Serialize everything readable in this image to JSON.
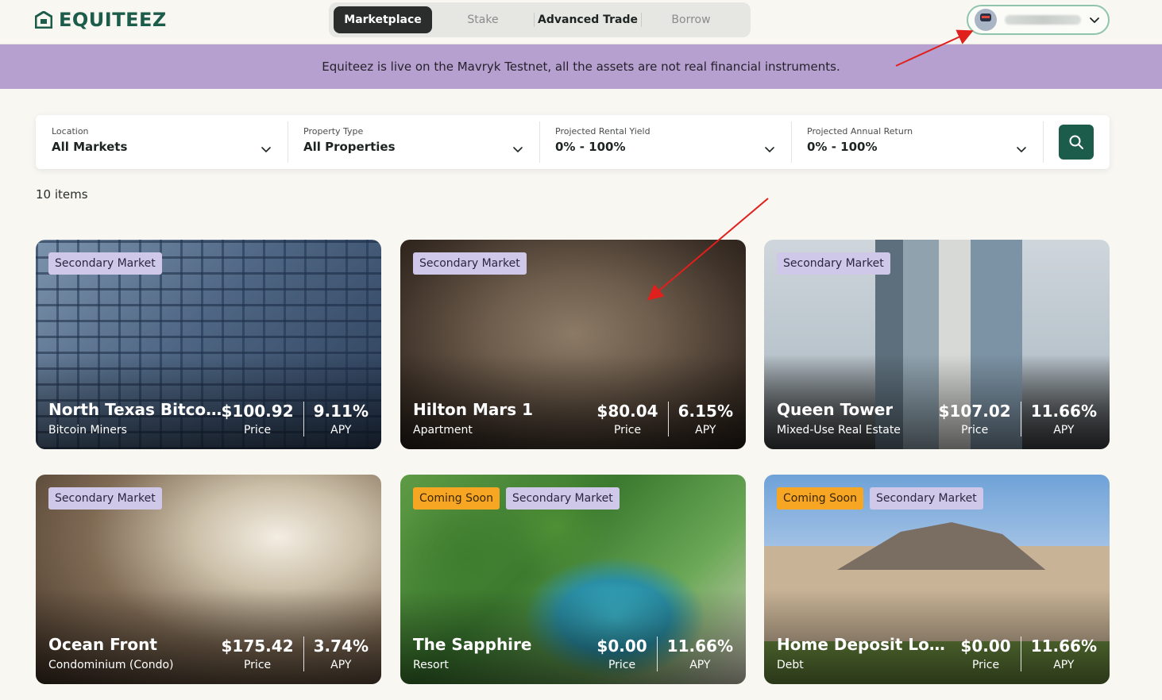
{
  "header": {
    "logo_text": "EQUITEEZ",
    "nav": [
      "Marketplace",
      "Stake",
      "Advanced Trade",
      "Borrow"
    ],
    "account": {
      "avatar_icon": "robot-avatar-icon",
      "name_blurred": true
    }
  },
  "banner": {
    "text": "Equiteez is live on the Mavryk Testnet, all the assets are not real financial instruments.",
    "color": "#b6a0cf"
  },
  "filters": [
    {
      "label": "Location",
      "value": "All Markets"
    },
    {
      "label": "Property Type",
      "value": "All Properties"
    },
    {
      "label": "Projected Rental Yield",
      "value": "0% - 100%"
    },
    {
      "label": "Projected Annual Return",
      "value": "0% - 100%"
    }
  ],
  "items_count": "10 items",
  "stat_labels": {
    "price": "Price",
    "apy": "APY"
  },
  "cards": [
    {
      "badges": [
        "Secondary Market"
      ],
      "title": "North Texas Bitcoin...",
      "subtitle": "Bitcoin Miners",
      "price": "$100.92",
      "apy": "9.11%"
    },
    {
      "badges": [
        "Secondary Market"
      ],
      "title": "Hilton Mars 1",
      "subtitle": "Apartment",
      "price": "$80.04",
      "apy": "6.15%"
    },
    {
      "badges": [
        "Secondary Market"
      ],
      "title": "Queen Tower",
      "subtitle": "Mixed-Use Real Estate",
      "price": "$107.02",
      "apy": "11.66%"
    },
    {
      "badges": [
        "Secondary Market"
      ],
      "title": "Ocean Front",
      "subtitle": "Condominium (Condo)",
      "price": "$175.42",
      "apy": "3.74%"
    },
    {
      "badges": [
        "Coming Soon",
        "Secondary Market"
      ],
      "title": "The Sapphire",
      "subtitle": "Resort",
      "price": "$0.00",
      "apy": "11.66%"
    },
    {
      "badges": [
        "Coming Soon",
        "Secondary Market"
      ],
      "title": "Home Deposit Loans",
      "subtitle": "Debt",
      "price": "$0.00",
      "apy": "11.66%"
    }
  ],
  "colors": {
    "brand": "#1c5c4a",
    "badge_secondary": "#cfc8e8",
    "badge_soon": "#f6a623",
    "annotation_arrow": "#e0201c"
  }
}
